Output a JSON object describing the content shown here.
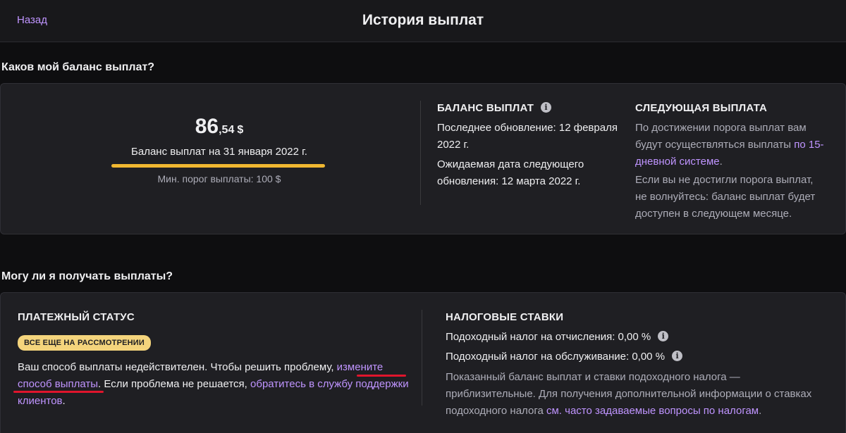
{
  "header": {
    "back_label": "Назад",
    "title": "История выплат"
  },
  "balance_section": {
    "heading": "Каков мой баланс выплат?",
    "amount_whole": "86",
    "amount_fraction": ",54",
    "currency": "$",
    "balance_date": "Баланс выплат на 31 января 2022 г.",
    "min_threshold": "Мин. порог выплаты: 100 $",
    "balance_column": {
      "title": "БАЛАНС ВЫПЛАТ",
      "last_update": "Последнее обновление: 12 февраля 2022 г.",
      "next_update": "Ожидаемая дата следующего обновления: 12 марта 2022 г."
    },
    "next_payout_column": {
      "title": "СЛЕДУЮЩАЯ ВЫПЛАТА",
      "text_before_link": "По достижении порога выплат вам будут осуществляться выплаты ",
      "link": "по 15-дневной системе",
      "text_after_link": ".",
      "note": "Если вы не достигли порога выплат, не волнуйтесь: баланс выплат будет доступен в следующем месяце."
    }
  },
  "eligibility_section": {
    "heading": "Могу ли я получать выплаты?",
    "payment_status": {
      "title": "ПЛАТЕЖНЫЙ СТАТУС",
      "badge": "ВСЕ ЕЩЕ НА РАССМОТРЕНИИ",
      "text_1": "Ваш способ выплаты недействителен. Чтобы решить проблему, ",
      "link_change": "измените способ выплаты",
      "text_2": ". Если проблема не решается, ",
      "link_support": "обратитесь в службу поддержки клиентов",
      "text_3": "."
    },
    "tax_rates": {
      "title": "НАЛОГОВЫЕ СТАВКИ",
      "income_tax_deductions": "Подоходный налог на отчисления: 0,00 %",
      "income_tax_service": "Подоходный налог на обслуживание: 0,00 %",
      "note_text": "Показанный баланс выплат и ставки подоходного налога — приблизительные. Для получения дополнительной информации о ставках подоходного налога ",
      "note_link": "см. часто задаваемые вопросы по налогам",
      "note_end": "."
    }
  },
  "colors": {
    "accent": "#bf94ff",
    "highlight_underline": "#f0b731",
    "badge_bg": "#f4d47c",
    "annotation_red": "#e0152c"
  },
  "icons": [
    "info-icon"
  ]
}
